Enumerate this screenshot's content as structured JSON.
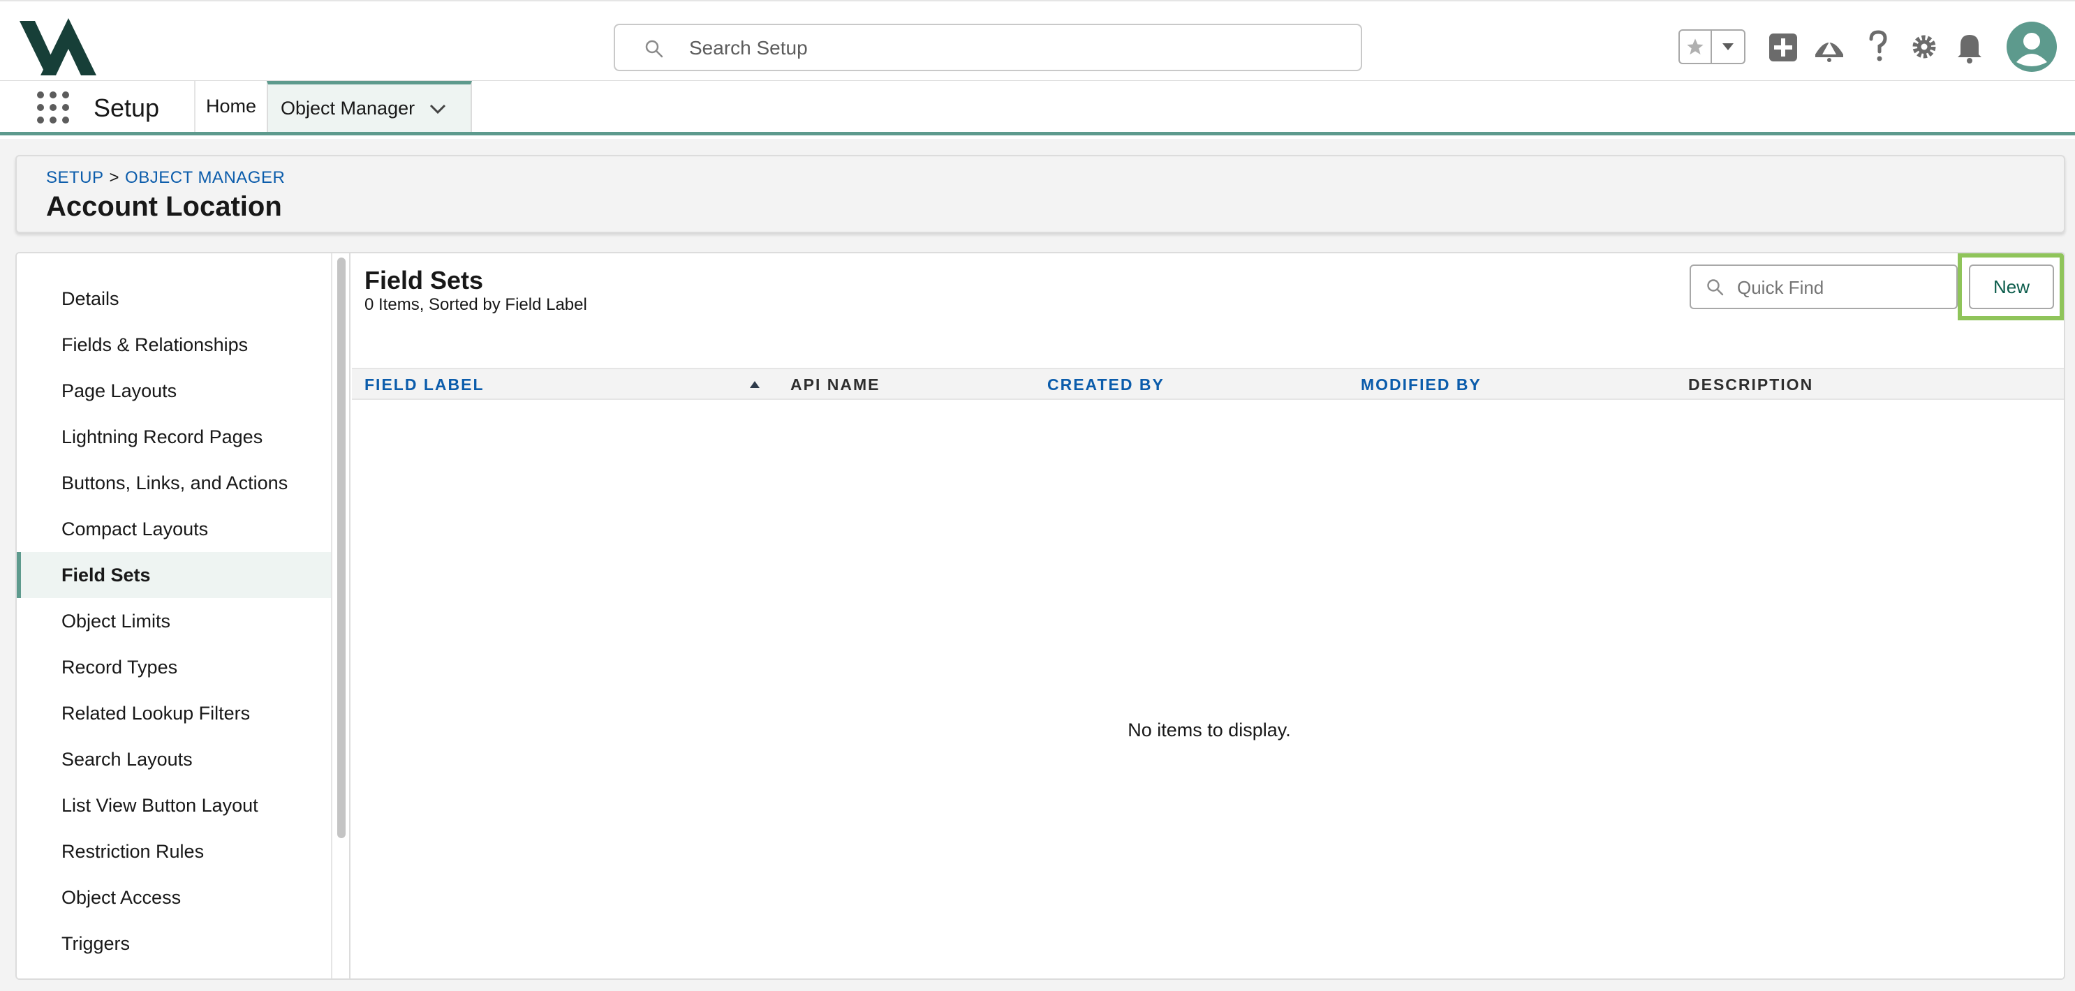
{
  "header": {
    "search_placeholder": "Search Setup",
    "icons": [
      "star-icon",
      "chevron-down-icon",
      "add-icon",
      "trailhead-icon",
      "help-icon",
      "gear-icon",
      "bell-icon",
      "avatar-icon"
    ]
  },
  "context_bar": {
    "app_name": "Setup",
    "nav_items": [
      "Home",
      "Object Manager"
    ]
  },
  "page_header": {
    "breadcrumb": [
      "SETUP",
      "OBJECT MANAGER"
    ],
    "breadcrumb_sep": ">",
    "title": "Account Location"
  },
  "sidebar": {
    "items": [
      "Details",
      "Fields & Relationships",
      "Page Layouts",
      "Lightning Record Pages",
      "Buttons, Links, and Actions",
      "Compact Layouts",
      "Field Sets",
      "Object Limits",
      "Record Types",
      "Related Lookup Filters",
      "Search Layouts",
      "List View Button Layout",
      "Restriction Rules",
      "Object Access",
      "Triggers"
    ],
    "active": "Field Sets"
  },
  "content": {
    "title": "Field Sets",
    "subtitle": "0 Items, Sorted by Field Label",
    "quick_find_placeholder": "Quick Find",
    "new_button": "New",
    "columns": [
      "FIELD LABEL",
      "API NAME",
      "CREATED BY",
      "MODIFIED BY",
      "DESCRIPTION"
    ],
    "empty_message": "No items to display."
  },
  "colors": {
    "brand_teal": "#5d9a8d",
    "link_blue": "#0b5cab",
    "highlight_green": "#8fc45a",
    "logo_dark": "#173f38"
  }
}
